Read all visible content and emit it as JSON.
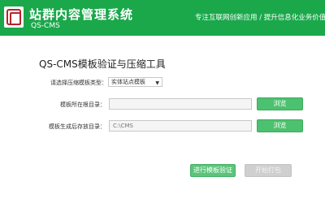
{
  "header": {
    "app_title": "站群内容管理系统",
    "app_subtitle": "QS-CMS",
    "slogan": "专注互联网创新应用 / 提升信息化业务价值",
    "logo_icon": "red-seal-logo-icon",
    "background_color": "#1aa84b"
  },
  "main": {
    "title": "QS-CMS模板验证与压缩工具"
  },
  "form": {
    "template_type_label": "请选择压缩模板类型：",
    "template_type_selected": "实体站点模板",
    "template_dir_label": "模板所在根目录：",
    "template_dir_value": "",
    "output_dir_label": "模板生成后存放目录：",
    "output_dir_value": "C:\\CMS",
    "browse_label": "浏览"
  },
  "actions": {
    "validate_label": "进行模板验证",
    "package_label": "开始打包",
    "accent_color": "#4cc16f",
    "disabled_color": "#cfcfcf"
  }
}
